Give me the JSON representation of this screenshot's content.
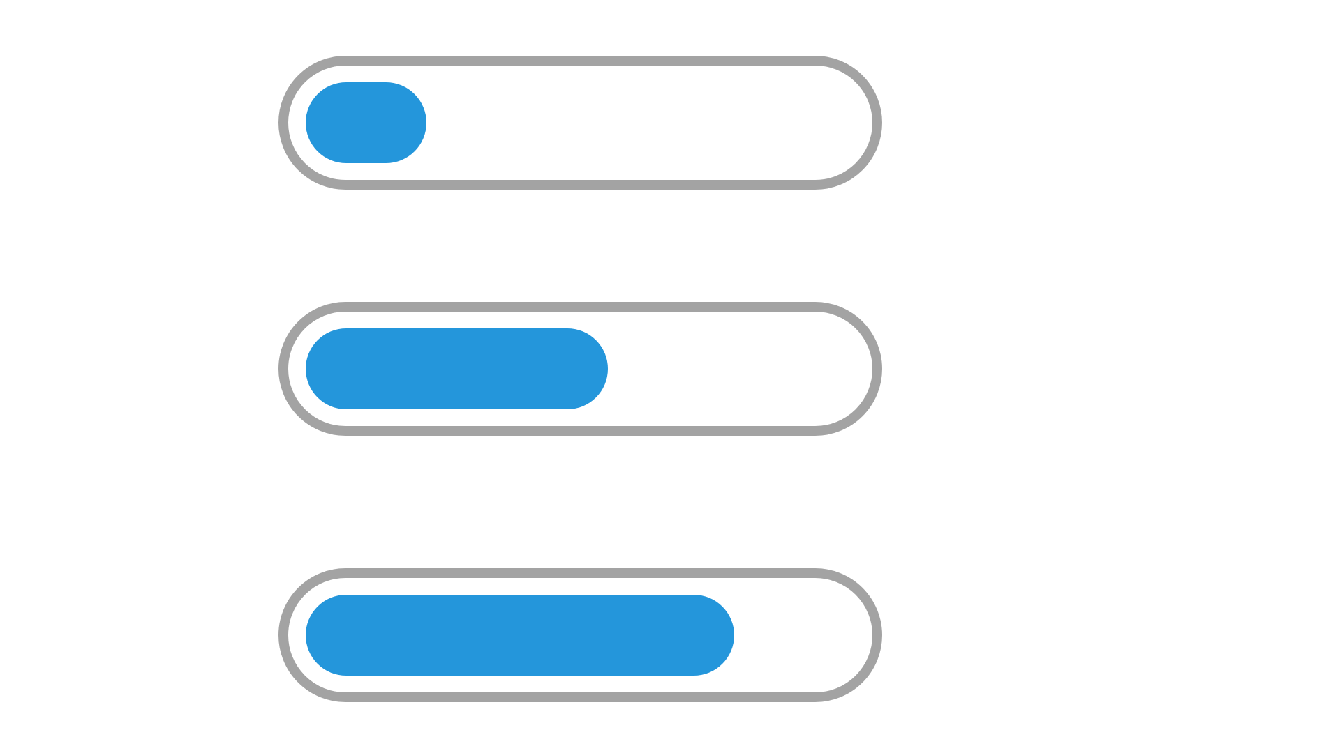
{
  "theme": {
    "track_color": "#a3a3a3",
    "fill_color": "#2496db",
    "background": "#ffffff"
  },
  "progress_bars": [
    {
      "value": 0.22
    },
    {
      "value": 0.55
    },
    {
      "value": 0.78
    }
  ]
}
